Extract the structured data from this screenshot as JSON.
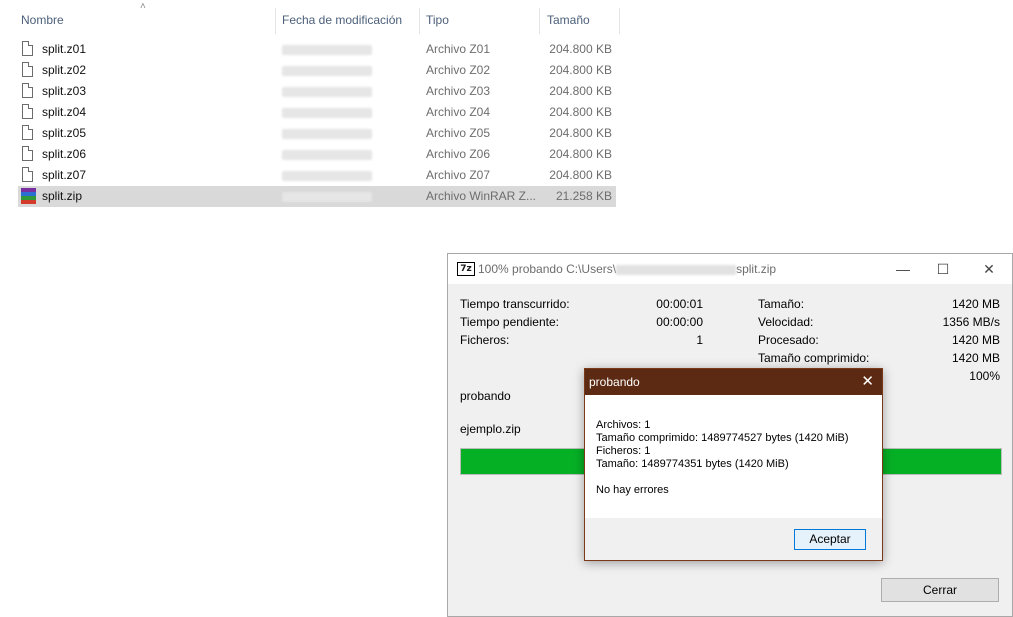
{
  "explorer": {
    "columns": {
      "name": "Nombre",
      "date": "Fecha de modificación",
      "type": "Tipo",
      "size": "Tamaño"
    },
    "files": [
      {
        "name": "split.z01",
        "type": "Archivo Z01",
        "size": "204.800 KB",
        "icon": "file-icon"
      },
      {
        "name": "split.z02",
        "type": "Archivo Z02",
        "size": "204.800 KB",
        "icon": "file-icon"
      },
      {
        "name": "split.z03",
        "type": "Archivo Z03",
        "size": "204.800 KB",
        "icon": "file-icon"
      },
      {
        "name": "split.z04",
        "type": "Archivo Z04",
        "size": "204.800 KB",
        "icon": "file-icon"
      },
      {
        "name": "split.z05",
        "type": "Archivo Z05",
        "size": "204.800 KB",
        "icon": "file-icon"
      },
      {
        "name": "split.z06",
        "type": "Archivo Z06",
        "size": "204.800 KB",
        "icon": "file-icon"
      },
      {
        "name": "split.z07",
        "type": "Archivo Z07",
        "size": "204.800 KB",
        "icon": "file-icon"
      },
      {
        "name": "split.zip",
        "type": "Archivo WinRAR Z...",
        "size": "21.258 KB",
        "icon": "winrar-archive-icon",
        "selected": true
      }
    ]
  },
  "sevenzip": {
    "logo": "7z",
    "title_prefix": "100% probando C:\\Users\\",
    "title_suffix": "split.zip",
    "stats_left": [
      {
        "label": "Tiempo transcurrido:",
        "value": "00:00:01"
      },
      {
        "label": "Tiempo pendiente:",
        "value": "00:00:00"
      },
      {
        "label": "Ficheros:",
        "value": "1"
      }
    ],
    "stats_right": [
      {
        "label": "Tamaño:",
        "value": "1420 MB"
      },
      {
        "label": "Velocidad:",
        "value": "1356 MB/s"
      },
      {
        "label": "Procesado:",
        "value": "1420 MB"
      },
      {
        "label": "Tamaño comprimido:",
        "value": "1420 MB"
      },
      {
        "label": "",
        "value": "100%"
      }
    ],
    "operation": "probando",
    "current_file": "ejemplo.zip",
    "progress": 1.0,
    "close_button": "Cerrar",
    "progress_color": "#06b025"
  },
  "dialog": {
    "title": "probando",
    "lines": [
      "Archivos: 1",
      "Tamaño comprimido: 1489774527 bytes (1420 MiB)",
      "Ficheros: 1",
      "Tamaño: 1489774351 bytes (1420 MiB)"
    ],
    "result": "No hay errores",
    "ok_button": "Aceptar",
    "title_color": "#5c2a12"
  }
}
